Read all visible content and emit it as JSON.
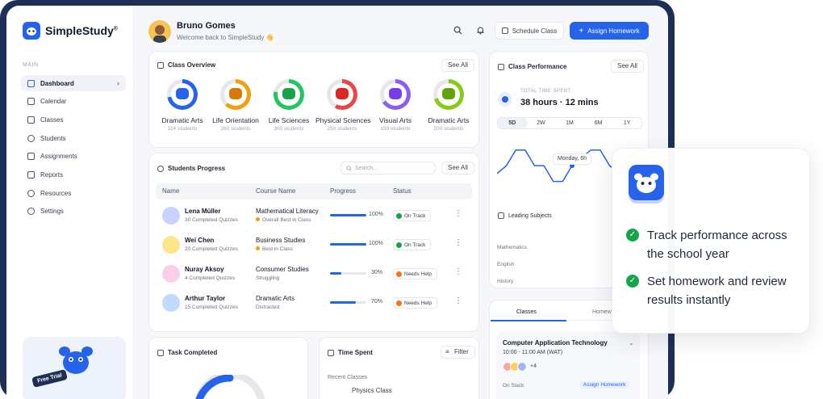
{
  "brand": {
    "name": "SimpleStudy",
    "mark": "®",
    "color": "#2563eb"
  },
  "sidebar": {
    "caption": "MAIN",
    "items": [
      {
        "label": "Dashboard",
        "icon": "grid-icon",
        "active": true
      },
      {
        "label": "Calendar",
        "icon": "calendar-icon"
      },
      {
        "label": "Classes",
        "icon": "book-icon"
      },
      {
        "label": "Students",
        "icon": "users-icon"
      },
      {
        "label": "Assignments",
        "icon": "clipboard-icon"
      },
      {
        "label": "Reports",
        "icon": "chart-icon"
      },
      {
        "label": "Resources",
        "icon": "globe-icon"
      },
      {
        "label": "Settings",
        "icon": "gear-icon"
      }
    ],
    "promo": "Free Trial"
  },
  "header": {
    "name": "Bruno Gomes",
    "greeting": "Welcome back to SimpleStudy 👋",
    "schedule_label": "Schedule Class",
    "assign_label": "Assign Homework"
  },
  "overview": {
    "title": "Class Overview",
    "see_all": "See All",
    "classes": [
      {
        "name": "Dramatic Arts",
        "count": "324 students",
        "color": "#2563eb",
        "mascot": "#2563eb",
        "progress": 0.72
      },
      {
        "name": "Life Orientation",
        "count": "260 students",
        "color": "#f59e0b",
        "mascot": "#d97706",
        "progress": 0.62
      },
      {
        "name": "Life Sciences",
        "count": "300 students",
        "color": "#22c55e",
        "mascot": "#16a34a",
        "progress": 0.78
      },
      {
        "name": "Physical Sciences",
        "count": "250 students",
        "color": "#ef4444",
        "mascot": "#dc2626",
        "progress": 0.58
      },
      {
        "name": "Visual Arts",
        "count": "150 students",
        "color": "#8b5cf6",
        "mascot": "#7c3aed",
        "progress": 0.66
      },
      {
        "name": "Dramatic Arts",
        "count": "200 students",
        "color": "#84cc16",
        "mascot": "#65a30d",
        "progress": 0.7
      }
    ]
  },
  "progress": {
    "title": "Students Progress",
    "search_placeholder": "Search...",
    "see_all": "See All",
    "columns": [
      "Name",
      "Course Name",
      "Progress",
      "Status"
    ],
    "rows": [
      {
        "name": "Lena Müller",
        "sub": "30 Completed Quizzes",
        "course": "Mathematical Literacy",
        "note": "Overall Best in Class",
        "note_dot": true,
        "progress": 1.0,
        "pct": "100%",
        "status": "On Track",
        "status_color": "#16a34a",
        "avatar": "#c7d2fe"
      },
      {
        "name": "Wei Chen",
        "sub": "20 Completed Quizzes",
        "course": "Business Studies",
        "note": "Best in Class",
        "note_dot": true,
        "progress": 1.0,
        "pct": "100%",
        "status": "On Track",
        "status_color": "#16a34a",
        "avatar": "#fde68a"
      },
      {
        "name": "Nuray Aksoy",
        "sub": "4 Completed Quizzes",
        "course": "Consumer Studies",
        "note": "Struggling",
        "note_dot": false,
        "progress": 0.3,
        "pct": "30%",
        "status": "Needs Help",
        "status_color": "#f97316",
        "avatar": "#fbcfe8"
      },
      {
        "name": "Arthur Taylor",
        "sub": "15 Completed Quizzes",
        "course": "Dramatic Arts",
        "note": "Distracted",
        "note_dot": false,
        "progress": 0.7,
        "pct": "70%",
        "status": "Needs Help",
        "status_color": "#f97316",
        "avatar": "#bfdbfe"
      }
    ]
  },
  "task": {
    "title": "Task Completed"
  },
  "time_spent": {
    "title": "Time Spent",
    "filter": "Filter",
    "recent": "Recent Classes",
    "first_row": "Physics Class"
  },
  "performance": {
    "title": "Class Performance",
    "see_all": "See All",
    "total_label": "TOTAL TIME SPENT",
    "total_value": "38 hours · 12 mins",
    "ranges": [
      "5D",
      "2W",
      "1M",
      "6M",
      "1Y"
    ],
    "active_range": "5D",
    "tooltip": "Monday, 6h",
    "leading_title": "Leading Subjects",
    "subjects": [
      "Mathematics",
      "English",
      "History"
    ],
    "chart_points": [
      3,
      4,
      6,
      6,
      4,
      4,
      2,
      2,
      4,
      5,
      6,
      6,
      4,
      3,
      5,
      6,
      6
    ]
  },
  "classes_panel": {
    "tabs": [
      "Classes",
      "Homework"
    ],
    "course": "Computer Application Technology",
    "time": "10:00 - 11:00 AM (WAT)",
    "extra": "+4",
    "status": "On Slack",
    "action": "Assign Homework"
  },
  "callout": {
    "points": [
      "Track performance across the school year",
      "Set homework and review results instantly"
    ]
  }
}
